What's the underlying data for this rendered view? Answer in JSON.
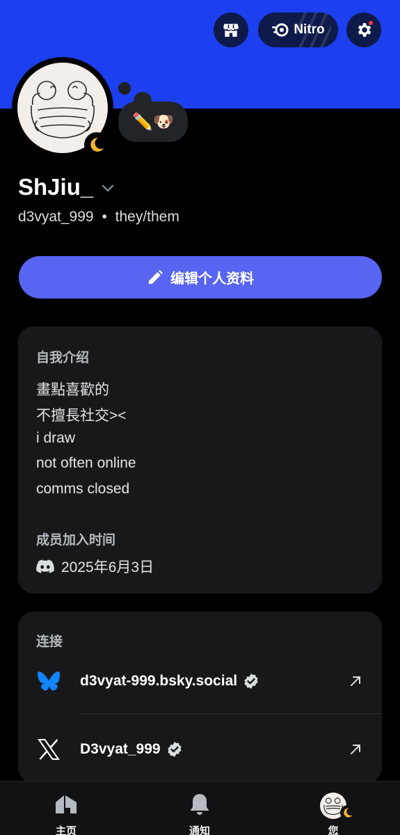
{
  "header": {
    "nitro_label": "Nitro",
    "banner_color": "#1c3ff0"
  },
  "profile": {
    "custom_status": "✏️🐶",
    "display_name": "ShJiu_",
    "username": "d3vyat_999",
    "pronouns": "they/them",
    "separator": "•"
  },
  "edit_button": {
    "label": "编辑个人资料",
    "color": "#5865f2"
  },
  "about": {
    "heading": "自我介绍",
    "bio_lines": [
      "畫點喜歡的",
      "不擅長社交><",
      "i draw",
      "not often online",
      "comms closed"
    ],
    "member_since_heading": "成员加入时间",
    "member_since_date": "2025年6月3日"
  },
  "connections": {
    "heading": "连接",
    "items": [
      {
        "icon": "bluesky-butterfly-icon",
        "name": "d3vyat-999.bsky.social",
        "verified": true
      },
      {
        "icon": "x-logo-icon",
        "name": "D3vyat_999",
        "verified": true
      }
    ]
  },
  "bottom_nav": {
    "items": [
      {
        "label": "主页",
        "icon": "home-icon"
      },
      {
        "label": "通知",
        "icon": "bell-icon"
      },
      {
        "label": "您",
        "icon": "avatar"
      }
    ]
  }
}
